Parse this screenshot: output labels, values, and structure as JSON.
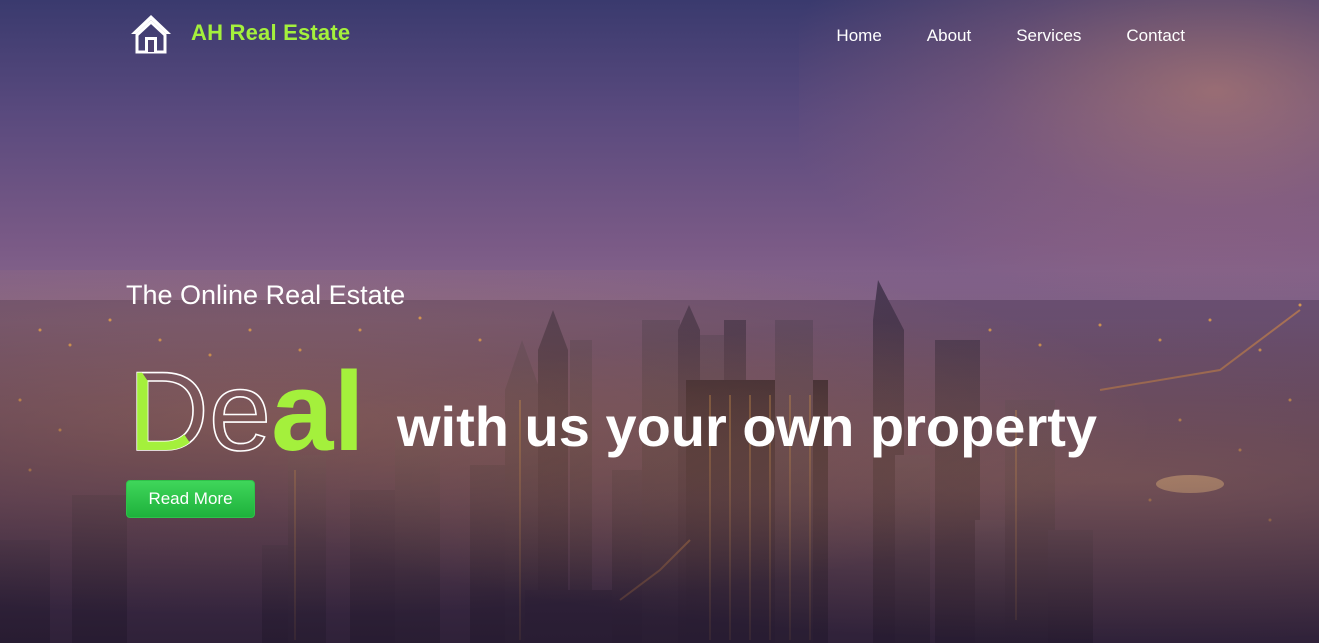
{
  "brand": {
    "name": "AH Real Estate",
    "icon": "house-icon",
    "color": "#a4f03c"
  },
  "nav": {
    "items": [
      {
        "label": "Home"
      },
      {
        "label": "About"
      },
      {
        "label": "Services"
      },
      {
        "label": "Contact"
      }
    ]
  },
  "hero": {
    "subtitle": "The Online Real Estate",
    "headline_word": "Deal",
    "headline_rest": "with us your own property",
    "cta_label": "Read More",
    "accent_color": "#a4f03c",
    "button_color": "#22b43f"
  }
}
